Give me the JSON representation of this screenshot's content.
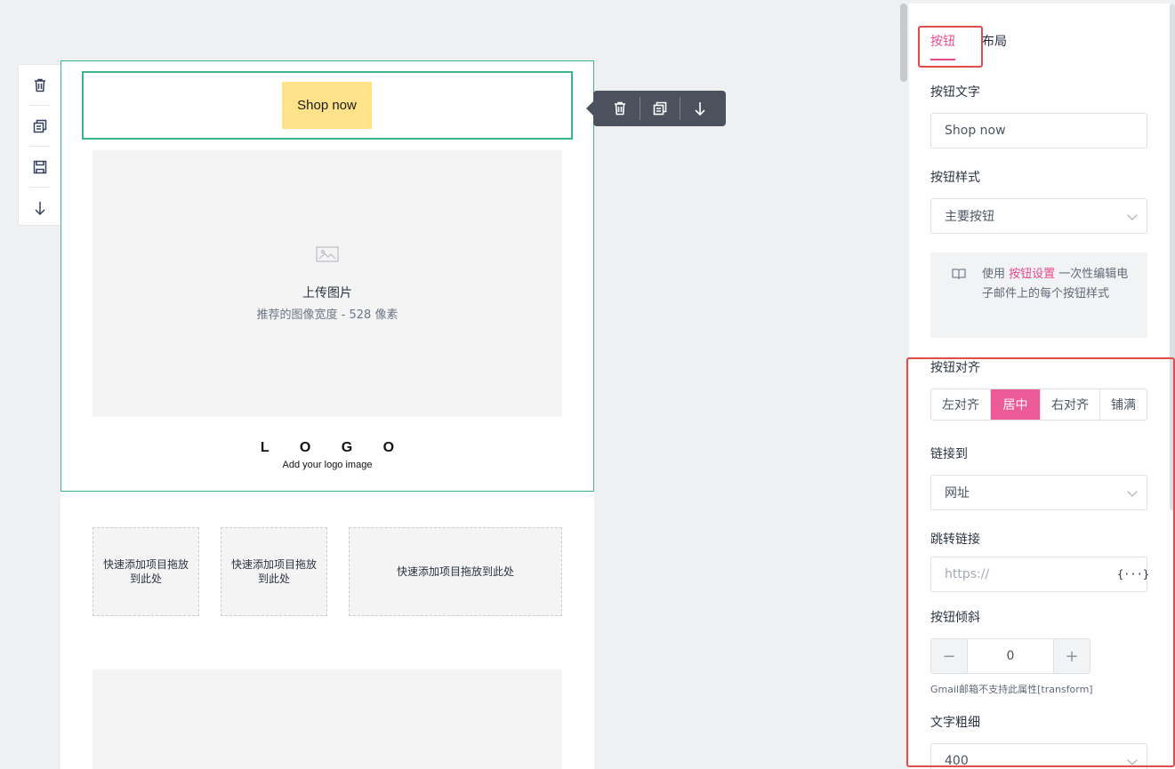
{
  "canvas": {
    "button_block": {
      "label": "Shop now"
    },
    "image_placeholder": {
      "title": "上传图片",
      "subtitle": "推荐的图像宽度 - 528 像素"
    },
    "logo": {
      "text": "L O G O",
      "subtitle": "Add your logo image"
    },
    "drop_zones": [
      {
        "label": "快速添加项目拖放到此处"
      },
      {
        "label": "快速添加项目拖放到此处"
      },
      {
        "label": "快速添加项目拖放到此处"
      }
    ],
    "left_toolbar": [
      "trash-icon",
      "copy-icon",
      "save-icon",
      "arrow-down-icon"
    ],
    "floating_toolbar": [
      "trash-icon",
      "copy-icon",
      "arrow-down-icon"
    ]
  },
  "panel": {
    "tabs": [
      {
        "label": "按钮",
        "active": true
      },
      {
        "label": "布局",
        "active": false
      }
    ],
    "button_text": {
      "label": "按钮文字",
      "value": "Shop now"
    },
    "button_style": {
      "label": "按钮样式",
      "value": "主要按钮"
    },
    "tip": {
      "prefix": "使用 ",
      "link": "按钮设置",
      "suffix": " 一次性编辑电子邮件上的每个按钮样式"
    },
    "alignment": {
      "label": "按钮对齐",
      "options": [
        "左对齐",
        "居中",
        "右对齐",
        "铺满"
      ],
      "selected": "居中"
    },
    "link_to": {
      "label": "链接到",
      "value": "网址"
    },
    "redirect_link": {
      "label": "跳转链接",
      "placeholder": "https://",
      "variable_icon": "{···}"
    },
    "skew": {
      "label": "按钮倾斜",
      "value": "0",
      "minus": "−",
      "plus": "+",
      "note": "Gmail邮箱不支持此属性[transform]"
    },
    "font_weight": {
      "label": "文字粗细",
      "value": "400"
    }
  },
  "colors": {
    "accent": "#e8498a",
    "selection": "#3db58a",
    "button_fill": "#ffe28a",
    "highlight": "#e24c4b"
  }
}
